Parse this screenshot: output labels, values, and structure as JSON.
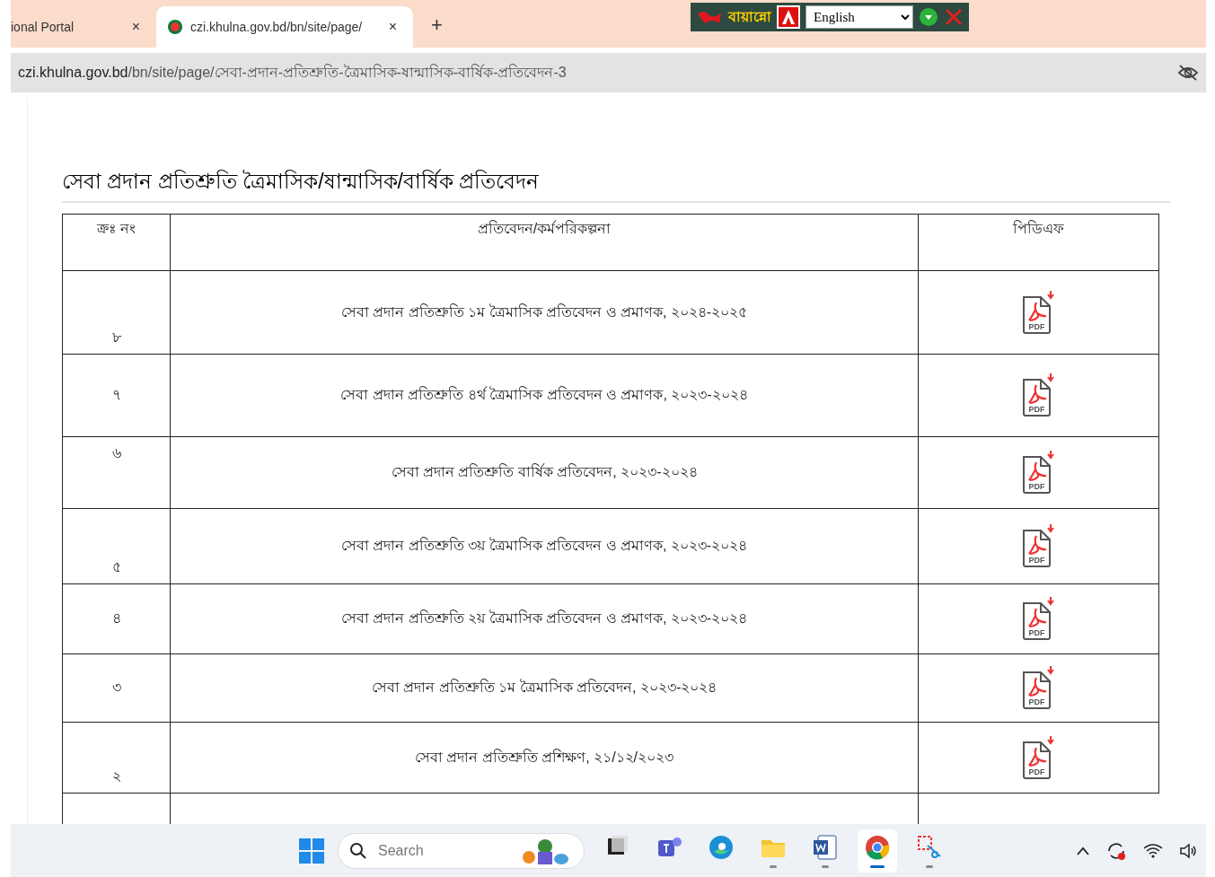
{
  "browser": {
    "tabs": [
      {
        "label": "ional Portal",
        "selected": false,
        "close": "×"
      },
      {
        "label": "czi.khulna.gov.bd/bn/site/page/",
        "selected": true,
        "close": "×"
      }
    ],
    "new_tab": "+",
    "translator": {
      "brand": "বায়ান্নো",
      "language": "English"
    },
    "address": {
      "host": "czi.khulna.gov.bd",
      "path": "/bn/site/page/সেবা-প্রদান-প্রতিশ্রুতি-ত্রৈমাসিক-ষান্মাসিক-বার্ষিক-প্রতিবেদন-3"
    }
  },
  "page": {
    "heading": "সেবা প্রদান প্রতিশ্রুতি ত্রৈমাসিক/ষান্মাসিক/বার্ষিক প্রতিবেদন",
    "table": {
      "columns": [
        "ক্রঃ নং",
        "প্রতিবেদন/কর্মপরিকল্পনা",
        "পিডিএফ"
      ],
      "rows": [
        {
          "serial": "৮",
          "title": "সেবা প্রদান প্রতিশ্রুতি ১ম ত্রৈমাসিক প্রতিবেদন ও প্রমাণক, ২০২৪-২০২৫",
          "pdf": "PDF"
        },
        {
          "serial": "৭",
          "title": "সেবা প্রদান প্রতিশ্রুতি ৪র্থ  ত্রৈমাসিক প্রতিবেদন ও প্রমাণক, ২০২৩-২০২৪",
          "pdf": "PDF"
        },
        {
          "serial": "৬",
          "title": "সেবা প্রদান প্রতিশ্রুতি বার্ষিক প্রতিবেদন, ২০২৩-২০২৪",
          "pdf": "PDF"
        },
        {
          "serial": "৫",
          "title": "সেবা প্রদান প্রতিশ্রুতি ৩য় ত্রৈমাসিক প্রতিবেদন ও প্রমাণক, ২০২৩-২০২৪",
          "pdf": "PDF"
        },
        {
          "serial": "৪",
          "title": "সেবা প্রদান প্রতিশ্রুতি ২য় ত্রৈমাসিক প্রতিবেদন ও প্রমাণক, ২০২৩-২০২৪",
          "pdf": "PDF"
        },
        {
          "serial": "৩",
          "title": "সেবা প্রদান প্রতিশ্রুতি ১ম ত্রৈমাসিক প্রতিবেদন, ২০২৩-২০২৪",
          "pdf": "PDF"
        },
        {
          "serial": "২",
          "title": "সেবা প্রদান প্রতিশ্রুতি প্রশিক্ষণ, ২১/১২/২০২৩",
          "pdf": "PDF"
        }
      ]
    }
  },
  "taskbar": {
    "search_placeholder": "Search",
    "apps": [
      {
        "kind": "files-stack",
        "running": false
      },
      {
        "kind": "teams",
        "running": false
      },
      {
        "kind": "edge",
        "running": false
      },
      {
        "kind": "folder",
        "running": true
      },
      {
        "kind": "word",
        "running": true
      },
      {
        "kind": "chrome",
        "running": true,
        "selected": true
      },
      {
        "kind": "snip",
        "running": true
      }
    ]
  }
}
